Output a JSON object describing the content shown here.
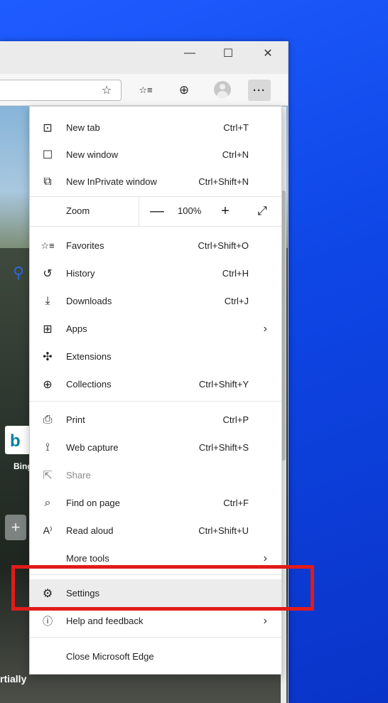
{
  "window_controls": {
    "minimize": "—",
    "maximize": "☐",
    "close": "✕"
  },
  "toolbar": {
    "add_favorite_icon": "☆",
    "favorites_icon": "☆≡",
    "collections_icon": "⊕",
    "more_label": "···"
  },
  "page": {
    "bing_label": "Bing",
    "partial_text": "rtially"
  },
  "menu": {
    "new_tab": {
      "label": "New tab",
      "shortcut": "Ctrl+T"
    },
    "new_window": {
      "label": "New window",
      "shortcut": "Ctrl+N"
    },
    "new_inprivate": {
      "label": "New InPrivate window",
      "shortcut": "Ctrl+Shift+N"
    },
    "zoom": {
      "label": "Zoom",
      "minus": "—",
      "value": "100%",
      "plus": "+",
      "fullscreen": "⤢"
    },
    "favorites": {
      "label": "Favorites",
      "shortcut": "Ctrl+Shift+O"
    },
    "history": {
      "label": "History",
      "shortcut": "Ctrl+H"
    },
    "downloads": {
      "label": "Downloads",
      "shortcut": "Ctrl+J"
    },
    "apps": {
      "label": "Apps",
      "chevron": "›"
    },
    "extensions": {
      "label": "Extensions"
    },
    "collections": {
      "label": "Collections",
      "shortcut": "Ctrl+Shift+Y"
    },
    "print": {
      "label": "Print",
      "shortcut": "Ctrl+P"
    },
    "web_capture": {
      "label": "Web capture",
      "shortcut": "Ctrl+Shift+S"
    },
    "share": {
      "label": "Share"
    },
    "find_on_page": {
      "label": "Find on page",
      "shortcut": "Ctrl+F"
    },
    "read_aloud": {
      "label": "Read aloud",
      "shortcut": "Ctrl+Shift+U"
    },
    "more_tools": {
      "label": "More tools",
      "chevron": "›"
    },
    "settings": {
      "label": "Settings"
    },
    "help_feedback": {
      "label": "Help and feedback",
      "chevron": "›"
    },
    "close_edge": {
      "label": "Close Microsoft Edge"
    }
  },
  "colors": {
    "highlight_box": "#e11b1b",
    "desktop": "#0b3fd4"
  }
}
